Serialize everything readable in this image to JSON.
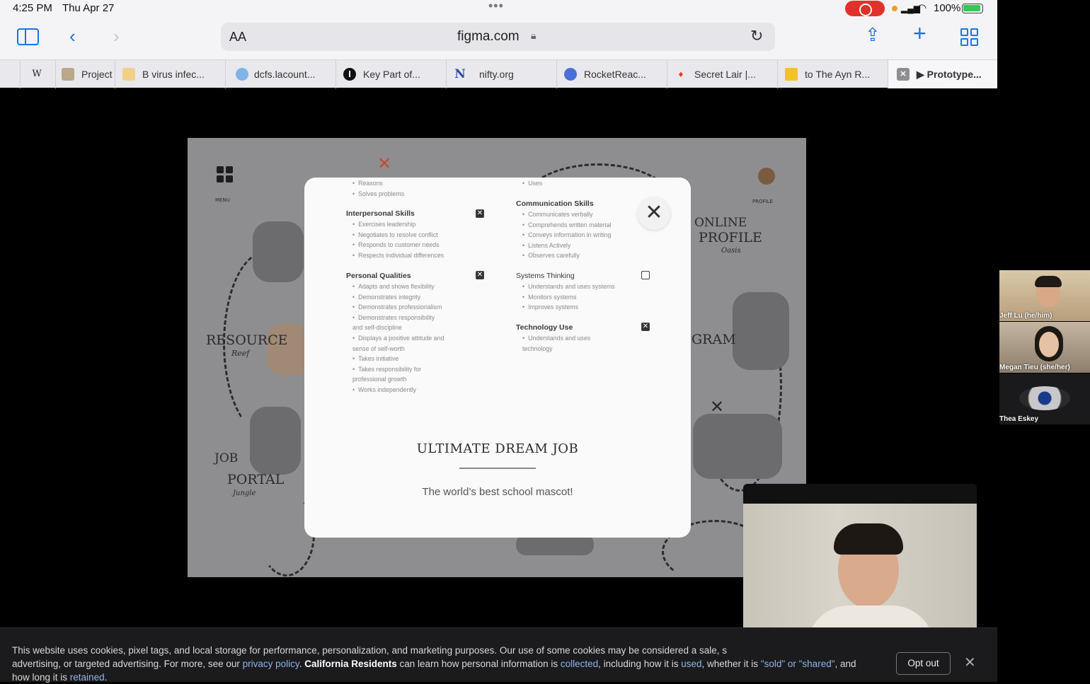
{
  "status": {
    "time": "4:25 PM",
    "date": "Thu Apr 27",
    "battery": "100%"
  },
  "browser": {
    "aa": "AA",
    "url": "figma.com",
    "tabs": [
      {
        "icon": "W",
        "label": ""
      },
      {
        "icon": "",
        "label": "Project"
      },
      {
        "icon": "",
        "label": "B virus infec..."
      },
      {
        "icon": "",
        "label": "dcfs.lacount..."
      },
      {
        "icon": "I",
        "label": "Key Part of..."
      },
      {
        "icon": "N",
        "label": "nifty.org"
      },
      {
        "icon": "",
        "label": "RocketReac..."
      },
      {
        "icon": "",
        "label": "Secret Lair |..."
      },
      {
        "icon": "",
        "label": "to The Ayn R..."
      },
      {
        "icon": "",
        "label": "▶ Prototype..."
      }
    ]
  },
  "map": {
    "menu_label": "MENU",
    "profile_label": "PROFILE",
    "online_profile": [
      "ONLINE",
      "PROFILE",
      "Oasis"
    ],
    "resource": [
      "RESOURCE",
      "Reef"
    ],
    "program": "GRAM",
    "job_portal": [
      "JOB",
      "PORTAL",
      "Jungle"
    ]
  },
  "modal": {
    "left_top_items": [
      "Reasons",
      "Solves problems"
    ],
    "right_top_items": [
      "Uses"
    ],
    "interpersonal": {
      "title": "Interpersonal Skills",
      "items": [
        "Exercises leadership",
        "Negotiates to resolve conflict",
        "Responds to customer needs",
        "Respects individual differences"
      ]
    },
    "personal": {
      "title": "Personal Qualities",
      "items": [
        "Adapts and shows flexibility",
        "Demonstrates integrity",
        "Demonstrates professionalism",
        "Demonstrates responsibility",
        "and self-discipline",
        "Displays a positive attitude and",
        "sense of self-worth",
        "Takes initiative",
        "Takes responsibility for",
        "professional growth",
        "Works independently"
      ]
    },
    "communication": {
      "title": "Communication Skills",
      "items": [
        "Communicates verbally",
        "Comprehends written material",
        "Conveys information in writing",
        "Listens Actively",
        "Observes carefully"
      ]
    },
    "systems": {
      "title": "Systems Thinking",
      "items": [
        "Understands and uses systems",
        "Monitors systems",
        "Improves systems"
      ]
    },
    "technology": {
      "title": "Technology Use",
      "items": [
        "Understands and uses",
        "technology"
      ]
    },
    "dream_title": "ULTIMATE DREAM JOB",
    "dream_sub": "The world’s best school mascot!"
  },
  "participants": [
    {
      "name": "Jeff Lu (he/him)"
    },
    {
      "name": "Megan Tieu (she/her)"
    },
    {
      "name": "Thea Eskey"
    }
  ],
  "cookie": {
    "t1": "This website uses cookies, pixel tags, and local storage for performance, personalization, and marketing purposes. Our use of some cookies may be considered a sale, s",
    "t2": "advertising, or targeted advertising. For more, see our ",
    "privacy": "privacy policy",
    "t3": ". ",
    "ca": "California Residents",
    "t4": " can learn how personal information is ",
    "collected": "collected",
    "t5": ", including how it is ",
    "used": "used",
    "t6": ", whether it is ",
    "sold": "\"sold\" or \"shared\"",
    "t7": ", and",
    "t8": "how long it is ",
    "retained": "retained",
    "t9": ".",
    "optout": "Opt out"
  }
}
